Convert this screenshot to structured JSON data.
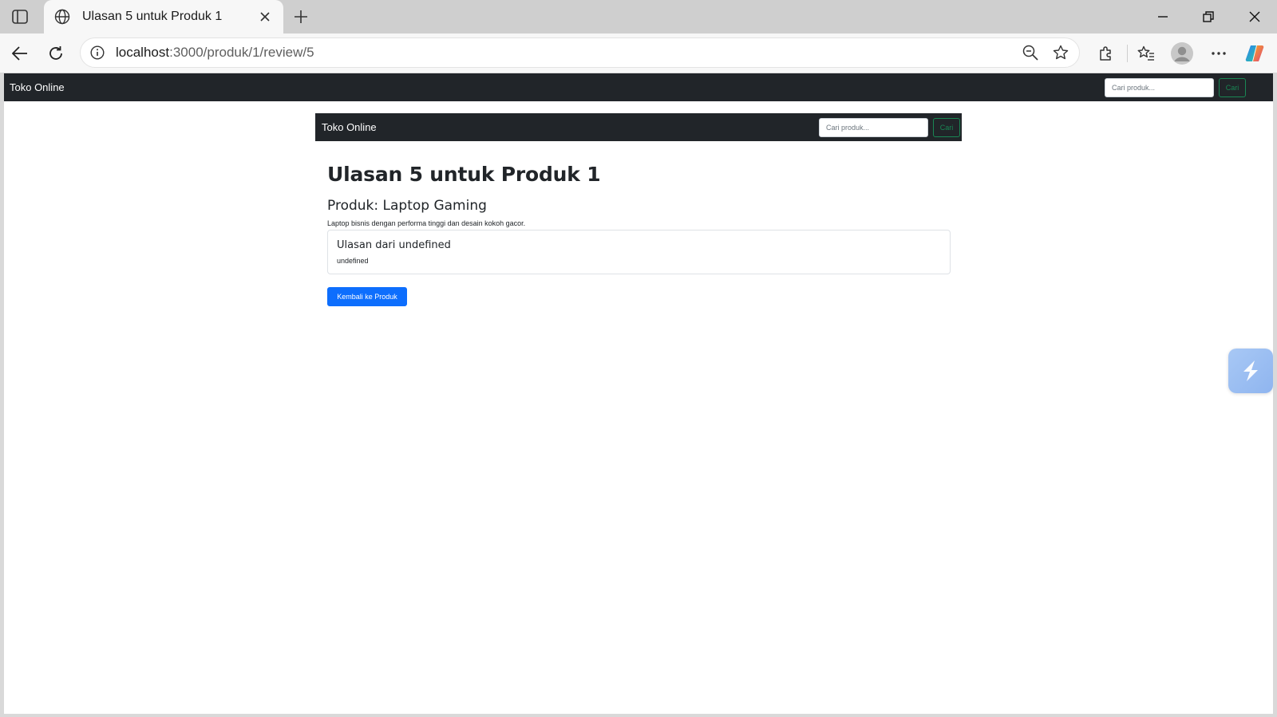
{
  "browser": {
    "tab_title": "Ulasan 5 untuk Produk 1",
    "url_host": "localhost",
    "url_path": ":3000/produk/1/review/5",
    "icons": [
      "tab-actions-icon",
      "globe-icon",
      "close-icon",
      "plus-icon",
      "minimize-icon",
      "restore-icon",
      "window-close-icon",
      "back-arrow-icon",
      "reload-icon",
      "info-icon",
      "zoom-out-icon",
      "star-icon",
      "extensions-icon",
      "favorites-icon",
      "profile-avatar-icon",
      "more-icon",
      "copilot-icon"
    ]
  },
  "navbar": {
    "brand": "Toko Online",
    "search_placeholder": "Cari produk...",
    "search_button": "Cari",
    "background": "#212529",
    "button_color": "#198754"
  },
  "inner_navbar": {
    "brand": "Toko Online",
    "search_placeholder": "Cari produk...",
    "search_button": "Cari"
  },
  "page": {
    "title": "Ulasan 5 untuk Produk 1",
    "product_heading": "Produk: Laptop Gaming",
    "product_description": "Laptop bisnis dengan performa tinggi dan desain kokoh gacor."
  },
  "review": {
    "title": "Ulasan dari undefined",
    "text": "undefined"
  },
  "actions": {
    "back_label": "Kembali ke Produk",
    "primary_color": "#0d6efd"
  },
  "side_widget": {
    "icon": "lightning-icon"
  }
}
